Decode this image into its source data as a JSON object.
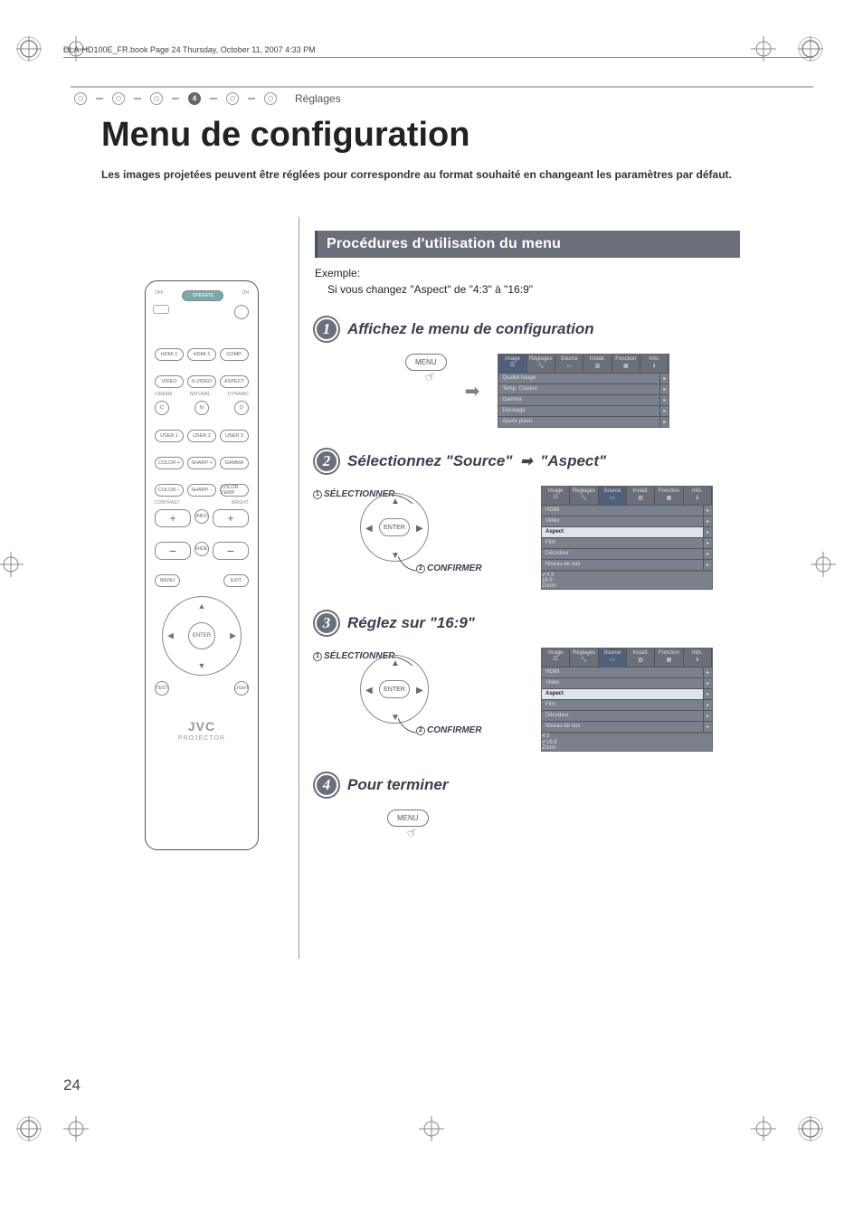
{
  "header": {
    "book_line": "DLA-HD100E_FR.book  Page 24  Thursday, October 11, 2007  4:33 PM"
  },
  "breadcrumb": {
    "active_index": 4,
    "label": "Réglages"
  },
  "title": "Menu de configuration",
  "intro": "Les images projetées peuvent être réglées pour correspondre au format souhaité en changeant les paramètres par défaut.",
  "section_heading": "Procédures d'utilisation du menu",
  "example": {
    "heading": "Exemple:",
    "text": "Si vous changez \"Aspect\" de \"4:3\" à \"16:9\""
  },
  "steps": [
    {
      "num": "1",
      "title": "Affichez le menu de configuration"
    },
    {
      "num": "2",
      "title_pre": "Sélectionnez \"Source\"",
      "title_post": "\"Aspect\""
    },
    {
      "num": "3",
      "title": "Réglez sur \"16:9\""
    },
    {
      "num": "4",
      "title": "Pour terminer"
    }
  ],
  "labels": {
    "menu_button": "MENU",
    "enter_button": "ENTER",
    "select": "SÉLECTIONNER",
    "confirm": "CONFIRMER"
  },
  "osd": {
    "tabs": [
      "Image",
      "Réglages",
      "Source",
      "Install.",
      "Fonction",
      "Info."
    ],
    "image_items": [
      "Qualité image",
      "Temp. Couleur",
      "Gamma",
      "Décalage",
      "Ajuste pixels"
    ],
    "source_items": [
      "HDMI",
      "Vidéo",
      "Aspect",
      "Film",
      "Décodeur",
      "Niveau de noir"
    ],
    "aspect_options_step2": [
      "4:3",
      "16:9",
      "Zoom"
    ],
    "aspect_options_step3": [
      "4:3",
      "16:9",
      "Zoom"
    ],
    "aspect_selected_step2": "4:3",
    "aspect_selected_step3": "16:9"
  },
  "remote": {
    "off": "OFF",
    "operate": "OPERATE",
    "on": "ON",
    "row1": [
      "HDMI 1",
      "HDMI 2",
      "COMP."
    ],
    "row2": [
      "VIDEO",
      "S-VIDEO",
      "ASPECT"
    ],
    "row3_labels": [
      "CINEMA",
      "NATURAL",
      "DYNAMIC"
    ],
    "row3": [
      "C",
      "N",
      "D"
    ],
    "row4": [
      "USER 1",
      "USER 2",
      "USER 3"
    ],
    "row5": [
      "COLOR +",
      "SHARP +",
      "GAMMA"
    ],
    "row6": [
      "COLOR −",
      "SHARP −",
      "COLOR TEMP"
    ],
    "contrast": "CONTRAST",
    "bright": "BRIGHT",
    "info": "INFO",
    "hide": "HIDE",
    "menu": "MENU",
    "exit": "EXIT",
    "enter": "ENTER",
    "test": "TEST",
    "light": "LIGHT",
    "brand": "JVC",
    "subbrand": "PROJECTOR"
  },
  "page_number": "24"
}
